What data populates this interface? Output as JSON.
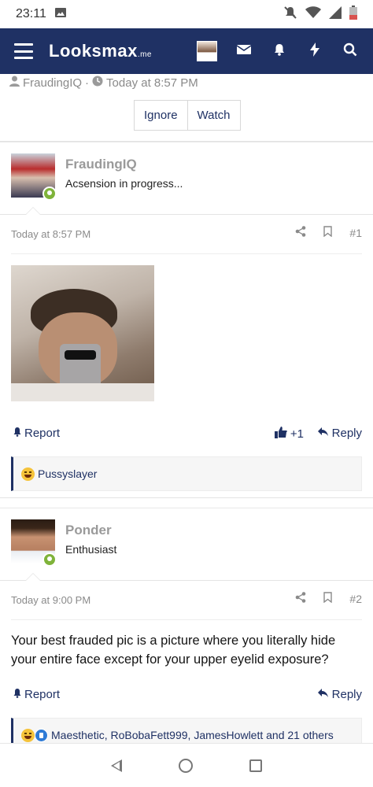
{
  "status_bar": {
    "time": "23:11",
    "icons": [
      "image-icon",
      "mute-icon",
      "wifi-icon",
      "signal-icon",
      "battery-icon"
    ]
  },
  "navbar": {
    "logo": "Looksmax",
    "logo_suffix": ".me",
    "icons": [
      "menu-icon",
      "avatar",
      "envelope-icon",
      "bell-icon",
      "bolt-icon",
      "search-icon"
    ]
  },
  "thread": {
    "author": "FraudingIQ",
    "separator": "·",
    "date": "Today at 8:57 PM",
    "ignore_label": "Ignore",
    "watch_label": "Watch"
  },
  "posts": [
    {
      "username": "FraudingIQ",
      "user_title": "Acsension in progress...",
      "date": "Today at 8:57 PM",
      "number": "#1",
      "report_label": "Report",
      "like_count": "+1",
      "reply_label": "Reply",
      "reactions_text": "Pussyslayer"
    },
    {
      "username": "Ponder",
      "user_title": "Enthusiast",
      "date": "Today at 9:00 PM",
      "number": "#2",
      "body": "Your best frauded pic is a picture where you literally hide your entire face except for your upper eyelid exposure?",
      "report_label": "Report",
      "reply_label": "Reply",
      "reactions_text": "Maesthetic, RoBobaFett999, JamesHowlett and 21 others"
    }
  ],
  "colors": {
    "navbar": "#1f3164",
    "link": "#1f3164",
    "online": "#7fb33a",
    "muted": "#8a8a8a"
  }
}
